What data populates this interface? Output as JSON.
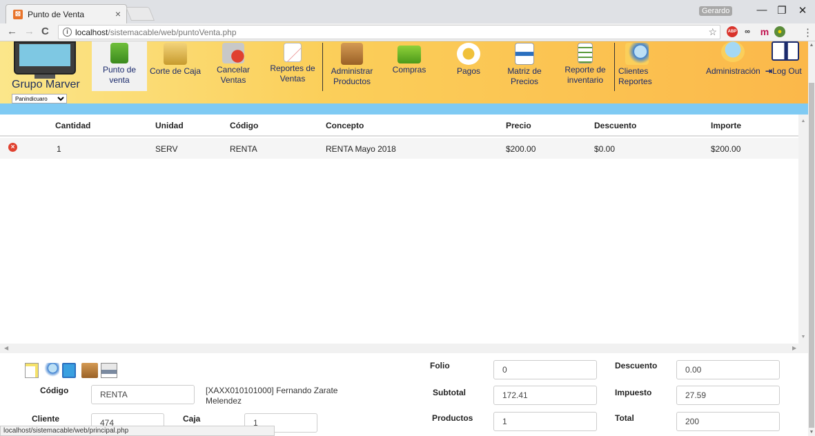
{
  "browser": {
    "tab_title": "Punto de Venta",
    "tab_close": "×",
    "profile_name": "Gerardo",
    "url_host": "localhost",
    "url_path": "/sistemacable/web/puntoVenta.php",
    "status_url": "localhost/sistemacable/web/principal.php",
    "minimize": "—",
    "maximize": "❐",
    "close": "✕",
    "back": "←",
    "forward": "→",
    "reload": "C",
    "star": "☆",
    "menu_dots": "⋮"
  },
  "app": {
    "brand_name": "Grupo Marver",
    "branch_select": "Panindicuaro",
    "menu": [
      {
        "label": "Punto de venta",
        "icon": "shopping-cart-icon"
      },
      {
        "label": "Corte de Caja",
        "icon": "cash-register-icon"
      },
      {
        "label": "Cancelar Ventas",
        "icon": "cancel-cart-icon"
      },
      {
        "label": "Reportes de Ventas",
        "icon": "sales-report-icon"
      },
      {
        "label": "Administrar Productos",
        "icon": "product-box-icon"
      },
      {
        "label": "Compras",
        "icon": "purchase-basket-icon"
      },
      {
        "label": "Pagos",
        "icon": "wallet-icon"
      },
      {
        "label": "Matriz de Precios",
        "icon": "price-matrix-icon"
      },
      {
        "label": "Reporte de inventario",
        "icon": "inventory-checklist-icon"
      },
      {
        "label": "Clientes Reportes",
        "icon": "client-search-icon"
      }
    ],
    "admin_label": "Administración",
    "logout_label": "Log Out"
  },
  "table": {
    "headers": [
      "Cantidad",
      "Unidad",
      "Código",
      "Concepto",
      "Precio",
      "Descuento",
      "Importe"
    ],
    "rows": [
      {
        "cantidad": "1",
        "unidad": "SERV",
        "codigo": "RENTA",
        "concepto": "RENTA Mayo 2018",
        "precio": "$200.00",
        "descuento": "$0.00",
        "importe": "$200.00"
      }
    ]
  },
  "form": {
    "codigo_label": "Código",
    "codigo_value": "RENTA",
    "client_name": "[XAXX010101000] Fernando Zarate Melendez",
    "cliente_label": "Cliente",
    "cliente_value": "474",
    "caja_label": "Caja",
    "caja_value": "1",
    "folio_label": "Folio",
    "folio_value": "0",
    "subtotal_label": "Subtotal",
    "subtotal_value": "172.41",
    "productos_label": "Productos",
    "productos_value": "1",
    "descuento_label": "Descuento",
    "descuento_value": "0.00",
    "impuesto_label": "Impuesto",
    "impuesto_value": "27.59",
    "total_label": "Total",
    "total_value": "200"
  }
}
